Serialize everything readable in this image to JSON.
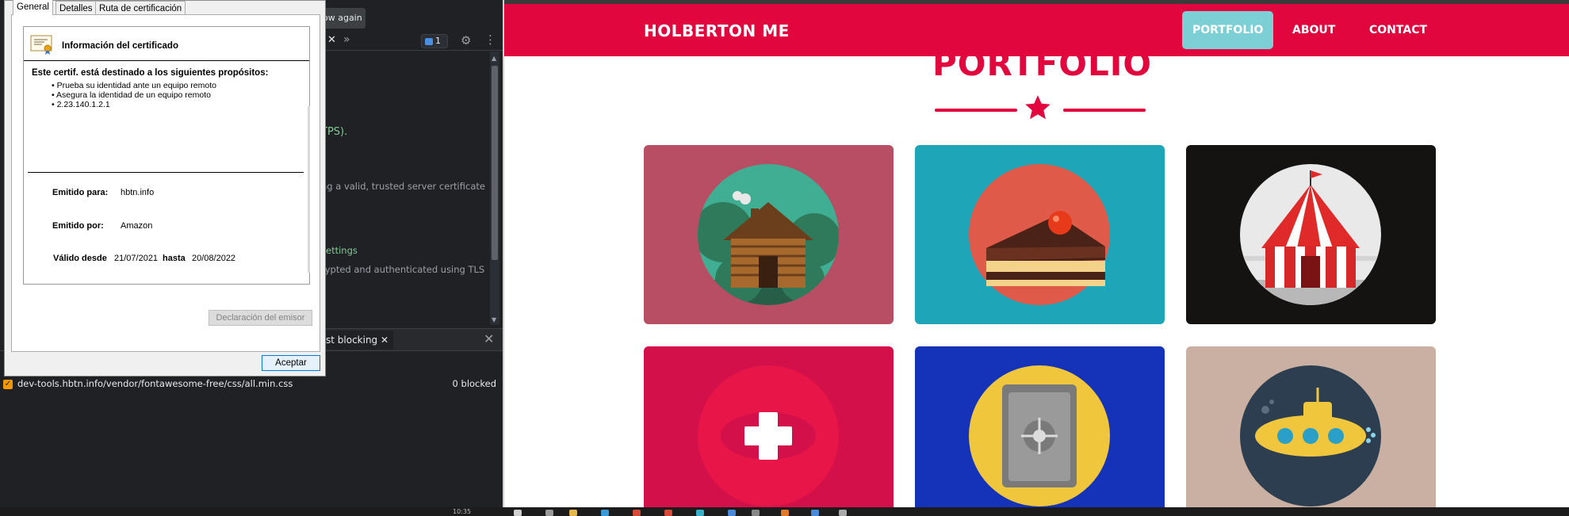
{
  "devtools": {
    "show_again_label": "ow again",
    "issues_count": "1",
    "security_text_1": "TPS).",
    "security_text_2": "ng a valid, trusted server certificate",
    "security_link": "settings",
    "security_text_3": "rypted and authenticated using TLS",
    "drawer_tab_label": "st blocking",
    "blocked_url": "dev-tools.hbtn.info/vendor/fontawesome-free/css/all.min.css",
    "blocked_count": "0 blocked"
  },
  "certificate": {
    "tabs": [
      "General",
      "Detalles",
      "Ruta de certificación"
    ],
    "title": "Información del certificado",
    "purpose_heading": "Este certif. está destinado a los siguientes propósitos:",
    "purposes": [
      "• Prueba su identidad ante un equipo remoto",
      "• Asegura la identidad de un equipo remoto",
      "• 2.23.140.1.2.1"
    ],
    "issued_to_label": "Emitido para:",
    "issued_to_value": "hbtn.info",
    "issued_by_label": "Emitido por:",
    "issued_by_value": "Amazon",
    "valid_from_label": "Válido desde",
    "valid_from_value": "21/07/2021",
    "valid_to_label": "hasta",
    "valid_to_value": "20/08/2022",
    "issuer_statement_button": "Declaración del emisor",
    "ok_button": "Aceptar"
  },
  "site": {
    "brand": "HOLBERTON ME",
    "nav": [
      "PORTFOLIO",
      "ABOUT",
      "CONTACT"
    ],
    "section_heading": "PORTFOLIO",
    "accent_color": "#e2063f",
    "active_nav_color": "#7ccfd4",
    "portfolio_items": [
      {
        "icon": "cabin-icon",
        "bg": "#b84e64"
      },
      {
        "icon": "cake-icon",
        "bg": "#1ea6b8"
      },
      {
        "icon": "circus-tent-icon",
        "bg": "#151212"
      },
      {
        "icon": "game-controller-icon",
        "bg": "#d4104a"
      },
      {
        "icon": "safe-icon",
        "bg": "#1433b8"
      },
      {
        "icon": "submarine-icon",
        "bg": "#c9b0a2"
      }
    ]
  },
  "taskbar": {
    "clock": "10:35"
  }
}
